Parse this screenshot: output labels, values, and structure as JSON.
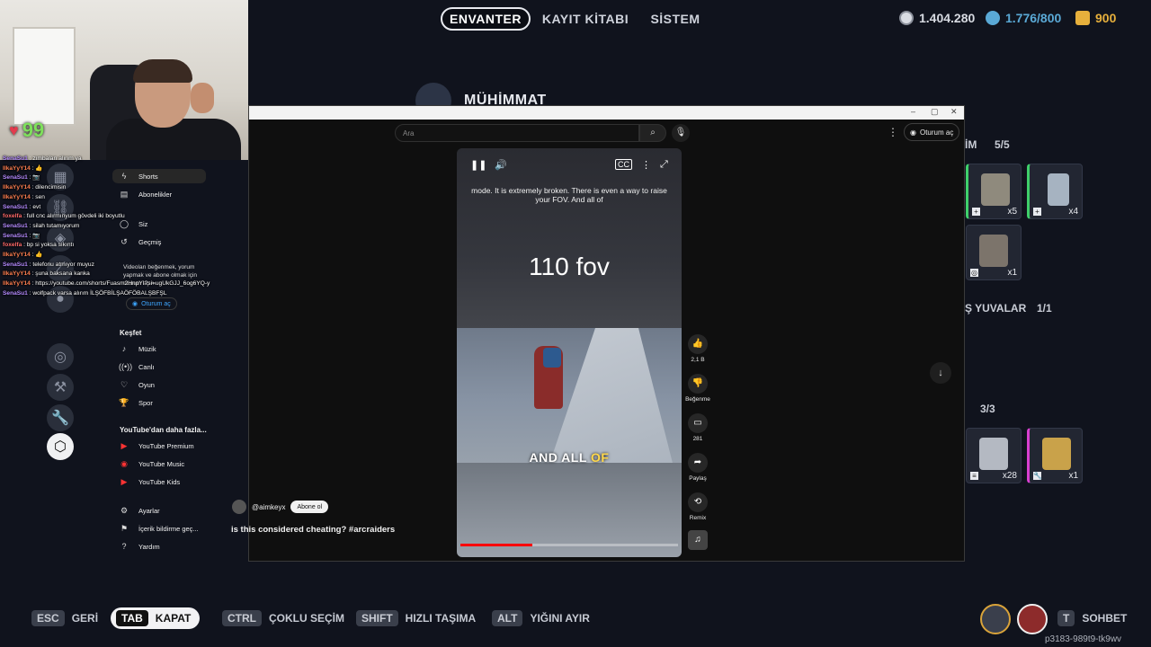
{
  "game": {
    "tabs": [
      {
        "label": "ENVANTER",
        "active": true
      },
      {
        "label": "KAYIT KİTABI",
        "active": false
      },
      {
        "label": "SİSTEM",
        "active": false
      }
    ],
    "currencies": [
      {
        "icon": "coin-icon",
        "value": "1.404.280",
        "color": "#e3e6ec"
      },
      {
        "icon": "token-icon",
        "value": "1.776/800",
        "color": "#5aa9d6"
      },
      {
        "icon": "raider-icon",
        "value": "900",
        "color": "#e7b03c"
      }
    ],
    "section_title": "MÜHİMMAT",
    "right_panel": {
      "label1": "İM",
      "count1": "5/5",
      "label2": "Ş YUVALAR",
      "count2": "1/1",
      "count3": "3/3",
      "slots": [
        {
          "count": "x5",
          "mark": "+"
        },
        {
          "count": "x4",
          "mark": "+"
        },
        {
          "count": "x1",
          "mark": "◎"
        },
        {
          "count": "x28",
          "mark": "≡"
        },
        {
          "count": "x1",
          "mark": "🔧"
        }
      ]
    },
    "hp": "99",
    "bottom_hints": [
      {
        "key": "ESC",
        "label": "GERİ"
      },
      {
        "key": "TAB",
        "label": "KAPAT",
        "active": true
      },
      {
        "key": "CTRL",
        "label": "ÇOKLU SEÇİM"
      },
      {
        "key": "SHIFT",
        "label": "HIZLI TAŞIMA"
      },
      {
        "key": "ALT",
        "label": "YIĞINI AYIR"
      },
      {
        "key": "T",
        "label": "SOHBET"
      }
    ],
    "session_code": "p3183-989t9-tk9wv"
  },
  "youtube": {
    "search_placeholder": "Ara",
    "signin_label": "Oturum aç",
    "sidebar": [
      {
        "icon": "shorts-icon",
        "label": "Shorts",
        "active": true
      },
      {
        "icon": "subscriptions-icon",
        "label": "Abonelikler"
      },
      {
        "icon": "you-icon",
        "label": "Siz"
      },
      {
        "icon": "history-icon",
        "label": "Geçmiş"
      }
    ],
    "signin_note": "Videoları beğenmek, yorum yapmak ve abone olmak için oturum açın.",
    "note_button": "Oturum aç",
    "explore_label": "Keşfet",
    "explore": [
      {
        "icon": "music-icon",
        "label": "Müzik"
      },
      {
        "icon": "live-icon",
        "label": "Canlı"
      },
      {
        "icon": "gaming-icon",
        "label": "Oyun"
      },
      {
        "icon": "sports-icon",
        "label": "Spor"
      }
    ],
    "more_label": "YouTube'dan daha fazla...",
    "more": [
      {
        "icon": "yt-premium-icon",
        "label": "YouTube Premium"
      },
      {
        "icon": "yt-music-icon",
        "label": "YouTube Music"
      },
      {
        "icon": "yt-kids-icon",
        "label": "YouTube Kids"
      }
    ],
    "settings": [
      {
        "icon": "settings-icon",
        "label": "Ayarlar"
      },
      {
        "icon": "flag-icon",
        "label": "İçerik bildirme geç..."
      },
      {
        "icon": "help-icon",
        "label": "Yardım"
      }
    ],
    "video": {
      "caption": "mode. It is extremely broken. There is even a way to raise your FOV. And all of",
      "overlay_text": "110 fov",
      "subtitle_main": "AND ALL",
      "subtitle_highlight": "OF",
      "progress": 0.33
    },
    "actions": [
      {
        "icon": "like-icon",
        "label": "2,1 B"
      },
      {
        "icon": "dislike-icon",
        "label": "Beğenme"
      },
      {
        "icon": "comment-icon",
        "label": "281"
      },
      {
        "icon": "share-icon",
        "label": "Paylaş"
      },
      {
        "icon": "remix-icon",
        "label": "Remix"
      }
    ],
    "channel": "@aimkeyx",
    "subscribe": "Abone ol",
    "title": "is this considered cheating? #arcraiders"
  },
  "chat": [
    {
      "user": "SenaSu1",
      "color": "#b58bff",
      "text": "zımbaları alırım ya"
    },
    {
      "user": "IlkaYyY14",
      "color": "#ff7f50",
      "text": "👍"
    },
    {
      "user": "SenaSu1",
      "color": "#b58bff",
      "text": "📷"
    },
    {
      "user": "IlkaYyY14",
      "color": "#ff7f50",
      "text": "dilencimisin"
    },
    {
      "user": "IlkaYyY14",
      "color": "#ff7f50",
      "text": "sen"
    },
    {
      "user": "SenaSu1",
      "color": "#b58bff",
      "text": "evt"
    },
    {
      "user": "foxelfa",
      "color": "#ff6a6a",
      "text": "full cnc alırmınyum gövdeli iki boyutlu"
    },
    {
      "user": "SenaSu1",
      "color": "#b58bff",
      "text": "silah tutamıyorum"
    },
    {
      "user": "SenaSu1",
      "color": "#b58bff",
      "text": "📷"
    },
    {
      "user": "foxelfa",
      "color": "#ff6a6a",
      "text": "bp si yoksa sıkıntı"
    },
    {
      "user": "IlkaYyY14",
      "color": "#ff7f50",
      "text": "👍"
    },
    {
      "user": "SenaSu1",
      "color": "#b58bff",
      "text": "telefonu atmıyor muyuz"
    },
    {
      "user": "IlkaYyY14",
      "color": "#ff7f50",
      "text": "şuna baksana kanka"
    },
    {
      "user": "IlkaYyY14",
      "color": "#ff7f50",
      "text": "https://youtube.com/shorts/Fuasm2HnpYI?si=ugUkGJJ_6og6YQ-y"
    },
    {
      "user": "SenaSu1",
      "color": "#b58bff",
      "text": "wolfpack varsa alırım İLŞÖFBİLŞAÖFÖBALŞBFŞL"
    }
  ]
}
